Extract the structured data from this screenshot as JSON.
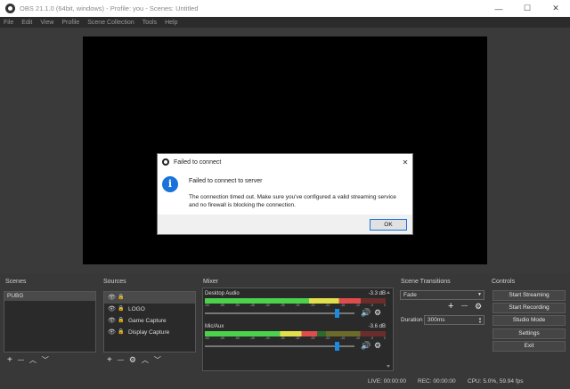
{
  "window": {
    "title": "OBS 21.1.0 (64bit, windows) - Profile: you - Scenes: Untitled",
    "minimize_glyph": "—",
    "maximize_glyph": "☐",
    "close_glyph": "✕"
  },
  "menu": [
    "File",
    "Edit",
    "View",
    "Profile",
    "Scene Collection",
    "Tools",
    "Help"
  ],
  "dialog": {
    "title": "Failed to connect",
    "heading": "Failed to connect to server",
    "message": "The connection timed out. Make sure you've configured a valid streaming service and no firewall is blocking the connection.",
    "ok_label": "OK",
    "info_glyph": "i",
    "close_glyph": "✕"
  },
  "scenes": {
    "title": "Scenes",
    "items": [
      "PUBG"
    ],
    "toolbar": {
      "add": "+",
      "remove": "—",
      "up": "︿",
      "down": "﹀"
    }
  },
  "sources": {
    "title": "Sources",
    "items": [
      {
        "label": "",
        "eye": "👁",
        "lock": "🔒"
      },
      {
        "label": "LOGO",
        "eye": "👁",
        "lock": "🔒"
      },
      {
        "label": "Game Capture",
        "eye": "👁",
        "lock": "🔒"
      },
      {
        "label": "Display Capture",
        "eye": "👁",
        "lock": "🔒"
      }
    ],
    "toolbar": {
      "add": "+",
      "remove": "—",
      "gear": "⚙",
      "up": "︿",
      "down": "﹀"
    }
  },
  "mixer": {
    "title": "Mixer",
    "channels": [
      {
        "name": "Desktop Audio",
        "db": "-3.3 dB",
        "level": 0.86,
        "fader": 0.88
      },
      {
        "name": "Mic/Aux",
        "db": "-3.6 dB",
        "level": 0.62,
        "fader": 0.88
      }
    ],
    "scale": [
      "-60",
      "-55",
      "-50",
      "-45",
      "-40",
      "-35",
      "-30",
      "-25",
      "-20",
      "-15",
      "-10",
      "-5",
      "0"
    ],
    "volume_glyph": "🔊",
    "gear_glyph": "⚙"
  },
  "transitions": {
    "title": "Scene Transitions",
    "selected": "Fade",
    "duration_label": "Duration",
    "duration_value": "300ms",
    "add": "+",
    "remove": "—",
    "gear": "⚙"
  },
  "controls": {
    "title": "Controls",
    "buttons": [
      "Start Streaming",
      "Start Recording",
      "Studio Mode",
      "Settings",
      "Exit"
    ]
  },
  "status": {
    "live": "LIVE: 00:00:00",
    "rec": "REC: 00:00:00",
    "cpu": "CPU: 5.0%, 59.94 fps"
  }
}
